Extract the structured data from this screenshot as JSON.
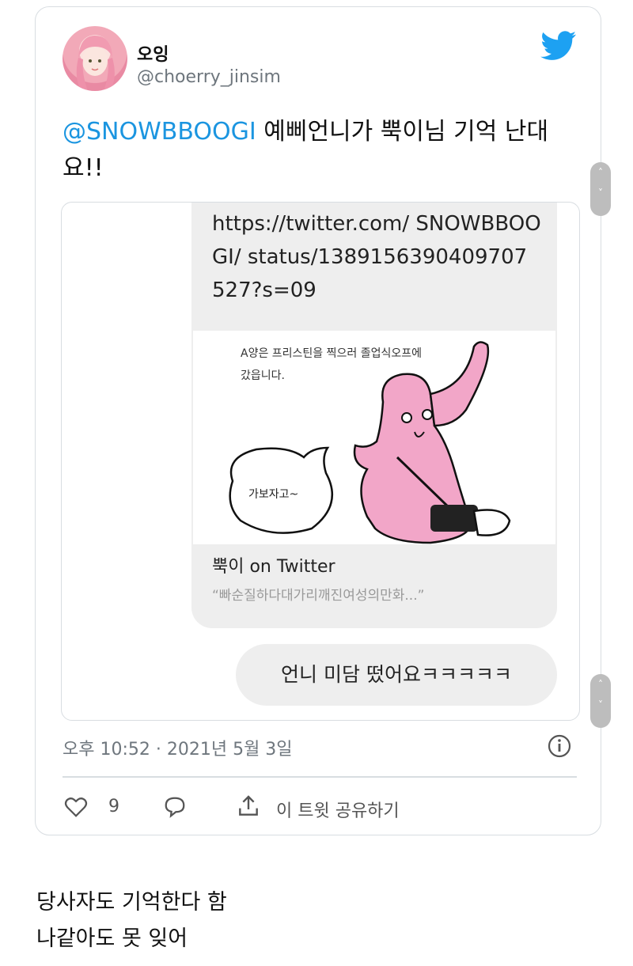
{
  "tweet": {
    "display_name": "오잉",
    "handle": "@choerry_jinsim",
    "mention": "@SNOWBBOOGI",
    "text_rest": " 예삐언니가 뿍이님 기억 난대요!!",
    "timestamp": "오후 10:52 · 2021년 5월 3일",
    "like_count": "9",
    "share_label": "이 트윗 공유하기"
  },
  "media": {
    "link_text": "https://twitter.com/ SNOWBBOOGI/ status/1389156390409707 527?s=09",
    "preview_caption1": "A양은 프리스틴을 찍으러 졸업식오프에",
    "preview_caption2": "갔읍니다.",
    "speech_text": "가보자고~",
    "card_title": "뿍이 on Twitter",
    "card_desc": "“빠순질하다대가리깨진여성의만화...”",
    "reply_text": "언니 미담 떴어요ㅋㅋㅋㅋㅋ"
  },
  "bottom_caption": {
    "line1": "당사자도 기억한다 함",
    "line2": "나같아도 못 잊어"
  },
  "icons": {
    "twitter": "twitter-bird-icon",
    "info": "info-icon",
    "like": "heart-icon",
    "reply": "reply-icon",
    "share": "share-icon"
  },
  "colors": {
    "mention": "#1b95e0",
    "twitter_blue": "#1da1f2",
    "muted": "#6e767d",
    "pink_character": "#f2a6c8"
  }
}
